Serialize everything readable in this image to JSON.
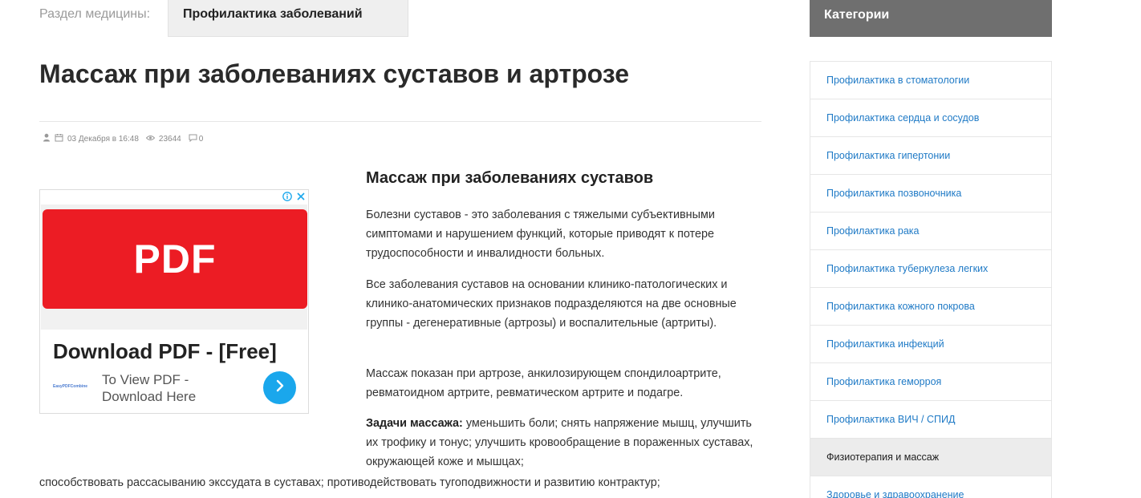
{
  "breadcrumb": {
    "label": "Раздел медицины:",
    "section": "Профилактика заболеваний"
  },
  "article": {
    "title": "Массаж при заболеваниях суставов и артрозе",
    "meta": {
      "date": "03 Декабря в 16:48",
      "views": "23644",
      "comments": "0"
    },
    "subtitle": "Массаж при заболеваниях суставов",
    "p1": "Болезни суставов - это заболевания с тяжелыми субъективными симптомами и нарушением функций, которые приводят к потере трудоспособности и инвалидности больных.",
    "p2": "Все заболевания суставов на основании клинико-патологических и клинико-анатомических признаков подразделяются на две основные группы - дегенеративные (артрозы) и воспалительные (артриты).",
    "p3": "Массаж показан при артрозе, анкилозирующем спондилоартрите, ревматоидном артрите, ревматическом артрите и подагре.",
    "p4_bold": "Задачи массажа:",
    "p4_text": " уменьшить боли; снять напряжение мышц, улучшить их трофику и тонус; улучшить кровообращение в пораженных суставах, окружающей коже и мышцах;",
    "p5": "способствовать рассасыванию экссудата в суставах; противодействовать тугоподвижности и развитию контрактур;"
  },
  "ad": {
    "banner_text": "PDF",
    "headline": "Download PDF - [Free]",
    "sub_line1": "To View PDF -",
    "sub_line2": "Download Here",
    "logo_text": "EasyPDFCombine",
    "info_icon": "info-icon",
    "close_icon": "close-icon"
  },
  "sidebar": {
    "heading": "Категории",
    "items": [
      {
        "label": "Профилактика в стоматологии"
      },
      {
        "label": "Профилактика сердца и сосудов"
      },
      {
        "label": "Профилактика гипертонии"
      },
      {
        "label": "Профилактика позвоночника"
      },
      {
        "label": "Профилактика рака"
      },
      {
        "label": "Профилактика туберкулеза легких"
      },
      {
        "label": "Профилактика кожного покрова"
      },
      {
        "label": "Профилактика инфекций"
      },
      {
        "label": "Профилактика геморроя"
      },
      {
        "label": "Профилактика ВИЧ / СПИД"
      },
      {
        "label": "Физиотерапия и массаж",
        "active": true
      },
      {
        "label": "Здоровье и здравоохранение"
      }
    ]
  },
  "colors": {
    "link": "#1f7ac6",
    "sidebar_header": "#6f6f6f",
    "ad_red": "#ec1c24",
    "ad_button": "#1aa7ec"
  }
}
